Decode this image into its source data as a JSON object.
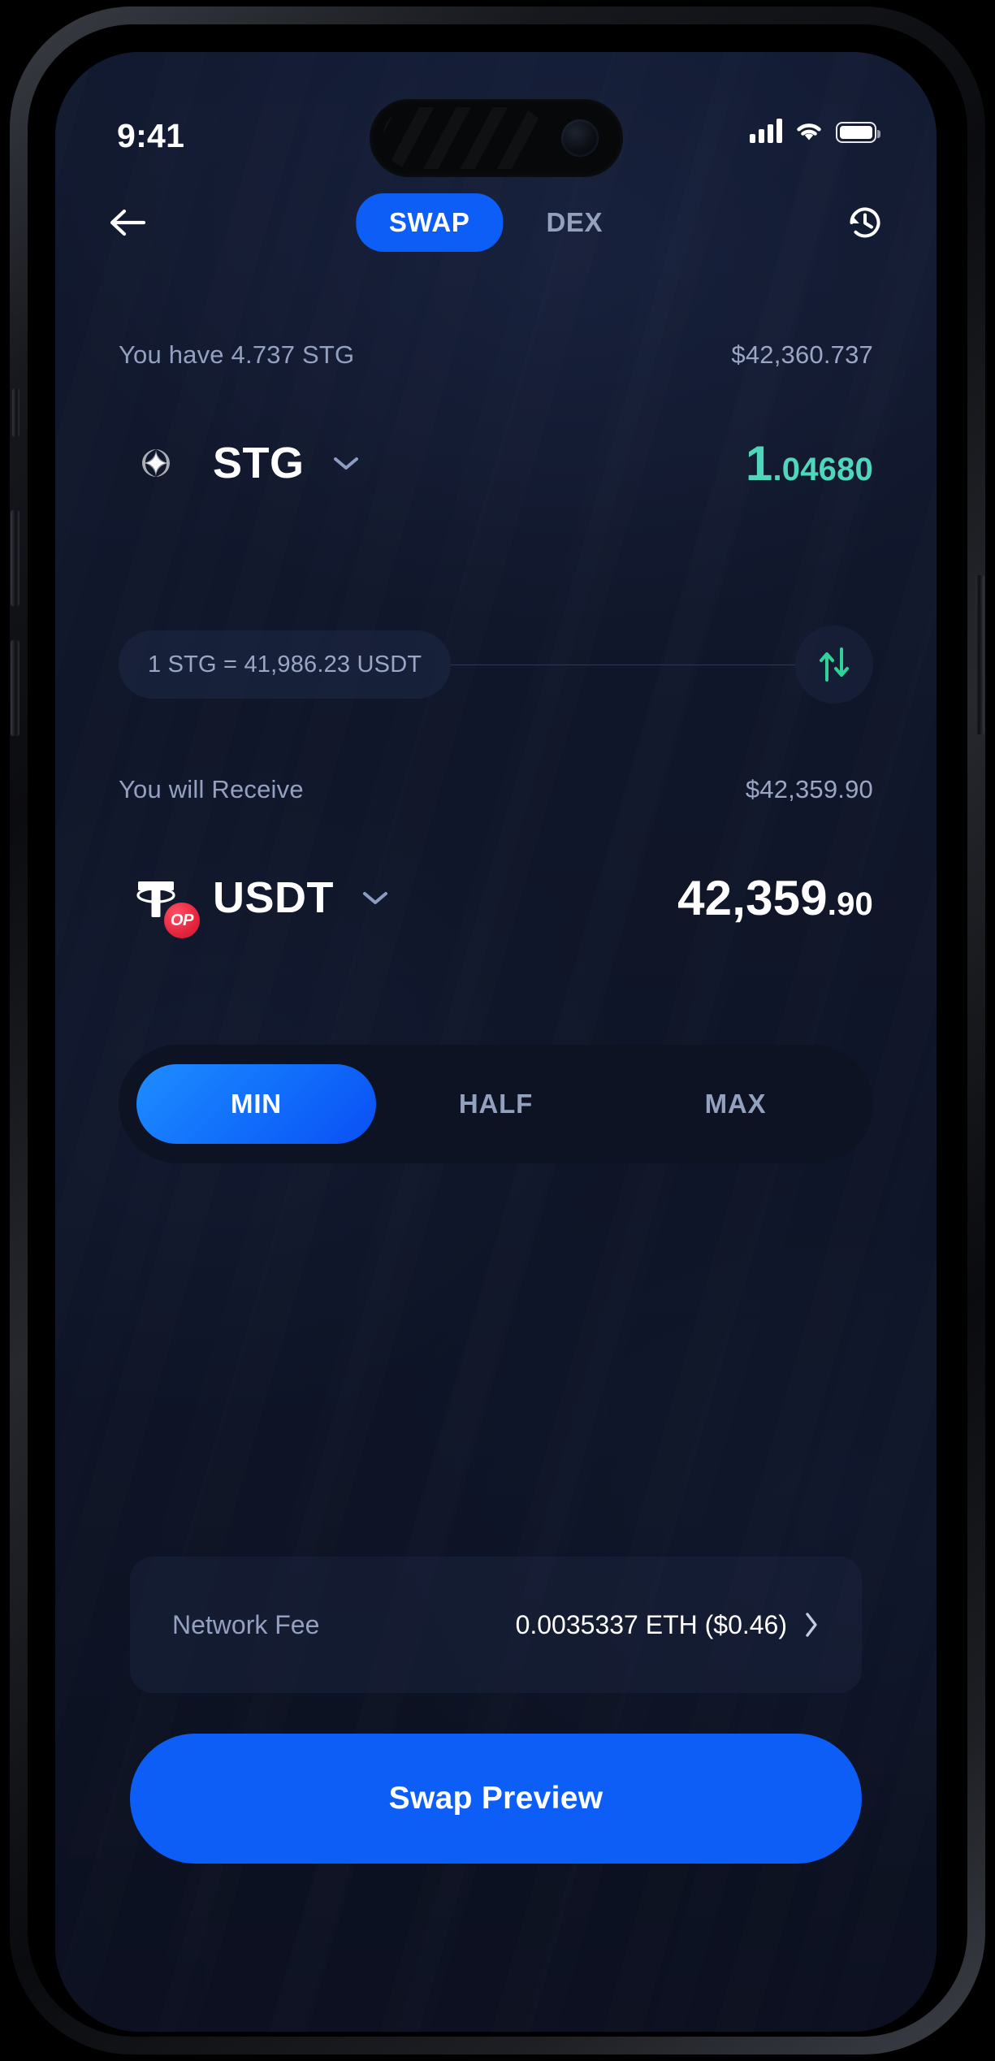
{
  "status_bar": {
    "time": "9:41",
    "signal_icon": "cellular-signal-icon",
    "wifi_icon": "wifi-icon",
    "battery_icon": "battery-icon"
  },
  "navbar": {
    "back_icon": "back-arrow-icon",
    "history_icon": "history-clock-icon",
    "tabs": [
      {
        "label": "SWAP",
        "active": true
      },
      {
        "label": "DEX",
        "active": false
      }
    ]
  },
  "pay_section": {
    "balance_label": "You have 4.737 STG",
    "fiat_value": "$42,360.737",
    "token_symbol": "STG",
    "token_logo": "stargate-stg-icon",
    "chevron_icon": "chevron-down-icon",
    "amount_int": "1",
    "amount_frac": ".04680"
  },
  "rate_row": {
    "rate_text": "1 STG = 41,986.23 USDT",
    "swap_icon": "swap-direction-icon"
  },
  "receive_section": {
    "label": "You will Receive",
    "fiat_value": "$42,359.90",
    "token_symbol": "USDT",
    "token_logo": "tether-usdt-icon",
    "network_badge": "OP",
    "chevron_icon": "chevron-down-icon",
    "amount_int": "42,359",
    "amount_frac": ".90"
  },
  "percent_selector": {
    "options": [
      {
        "label": "MIN",
        "active": true
      },
      {
        "label": "HALF",
        "active": false
      },
      {
        "label": "MAX",
        "active": false
      }
    ]
  },
  "network_fee": {
    "label": "Network Fee",
    "value": "0.0035337 ETH ($0.46)",
    "chevron_icon": "chevron-right-icon"
  },
  "cta": {
    "label": "Swap Preview"
  },
  "colors": {
    "accent_blue": "#0D5EF7",
    "teal_amount": "#4FD6BB",
    "muted_text": "#93A0C0",
    "background": "#101629",
    "usdt_green": "#26A17B",
    "op_red": "#E5253E"
  }
}
